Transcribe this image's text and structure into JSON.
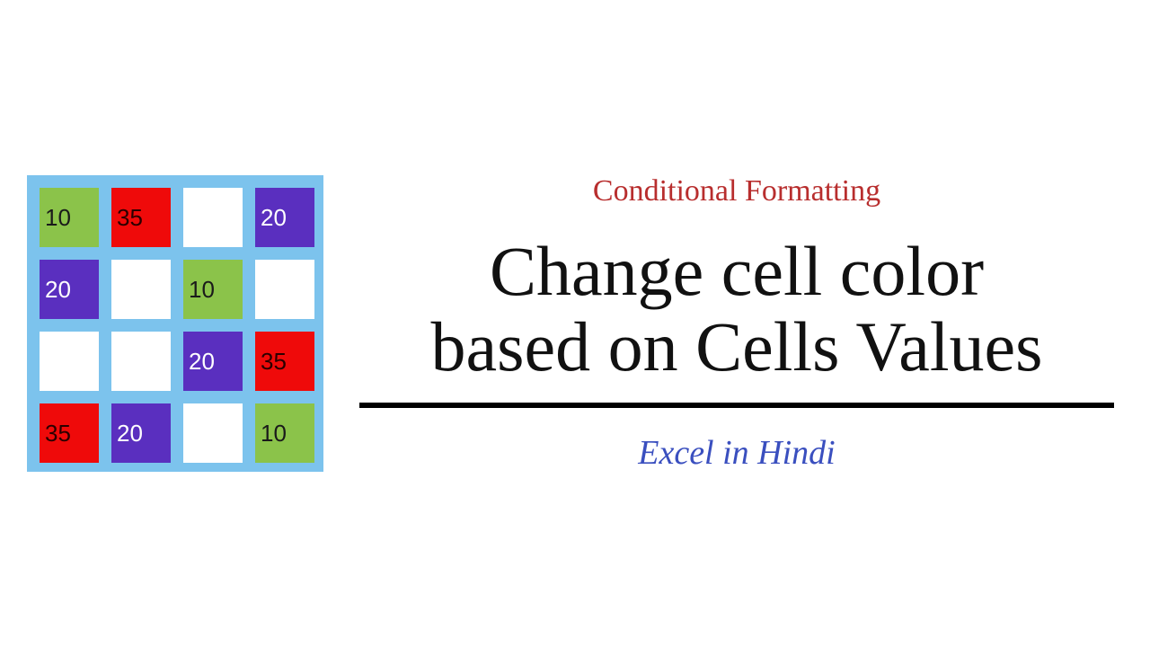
{
  "colors": {
    "grid_bg": "#7cc3ed",
    "green": "#8bc34a",
    "red": "#ef0a0a",
    "white": "#ffffff",
    "purple": "#5a2fbf",
    "supertitle": "#b82e2e",
    "title": "#111111",
    "subtitle": "#3a4fbf"
  },
  "grid": {
    "rows": [
      [
        {
          "value": "10",
          "color": "green"
        },
        {
          "value": "35",
          "color": "red"
        },
        {
          "value": "",
          "color": "white"
        },
        {
          "value": "20",
          "color": "purple"
        }
      ],
      [
        {
          "value": "20",
          "color": "purple"
        },
        {
          "value": "",
          "color": "white"
        },
        {
          "value": "10",
          "color": "green"
        },
        {
          "value": "",
          "color": "white"
        }
      ],
      [
        {
          "value": "",
          "color": "white"
        },
        {
          "value": "",
          "color": "white"
        },
        {
          "value": "20",
          "color": "purple"
        },
        {
          "value": "35",
          "color": "red"
        }
      ],
      [
        {
          "value": "35",
          "color": "red"
        },
        {
          "value": "20",
          "color": "purple"
        },
        {
          "value": "",
          "color": "white"
        },
        {
          "value": "10",
          "color": "green"
        }
      ]
    ]
  },
  "text": {
    "supertitle": "Conditional Formatting",
    "title_line1": "Change cell color",
    "title_line2": "based on Cells Values",
    "subtitle": "Excel in Hindi"
  }
}
